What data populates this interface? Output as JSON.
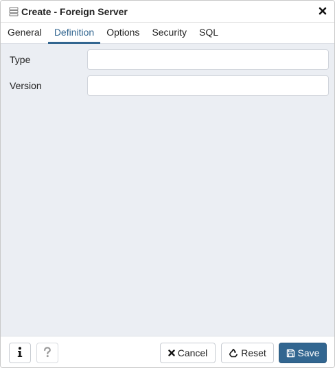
{
  "dialog": {
    "title": "Create - Foreign Server",
    "title_icon": "foreign-server-icon",
    "close_icon": "close-icon"
  },
  "tabs": [
    {
      "label": "General",
      "active": false
    },
    {
      "label": "Definition",
      "active": true
    },
    {
      "label": "Options",
      "active": false
    },
    {
      "label": "Security",
      "active": false
    },
    {
      "label": "SQL",
      "active": false
    }
  ],
  "form": {
    "type": {
      "label": "Type",
      "value": "",
      "placeholder": ""
    },
    "version": {
      "label": "Version",
      "value": "",
      "placeholder": ""
    }
  },
  "footer": {
    "info_icon": "info-icon",
    "help_icon": "help-icon",
    "cancel_label": "Cancel",
    "reset_label": "Reset",
    "save_label": "Save"
  },
  "colors": {
    "accent": "#326690",
    "body_background": "#ebeef3"
  }
}
